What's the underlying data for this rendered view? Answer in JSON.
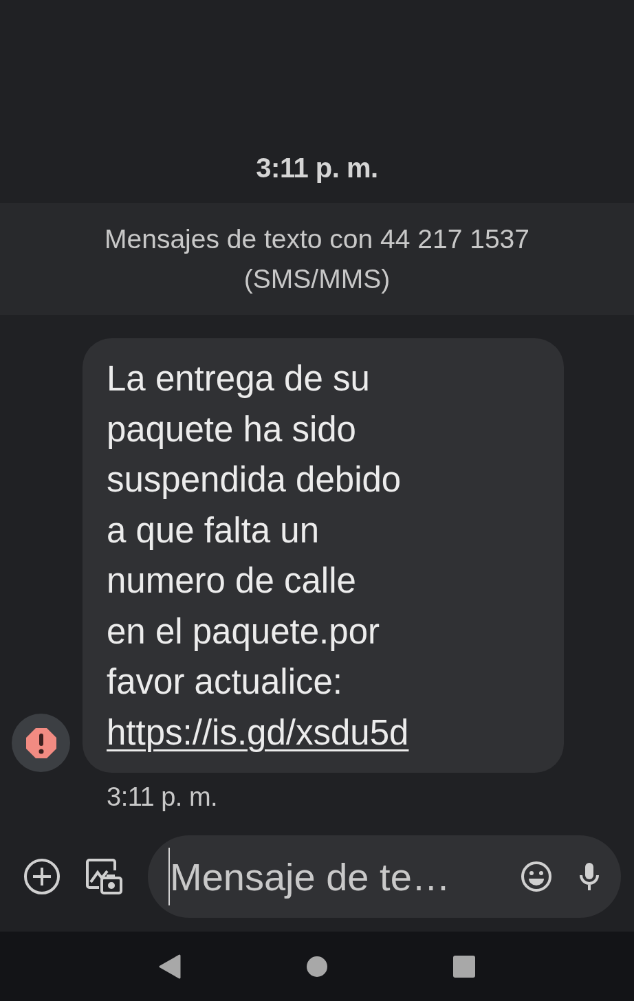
{
  "conversation": {
    "time_header": "3:11 p. m.",
    "banner": {
      "line_1": "Mensajes de texto con 44 217 1537",
      "line_2": "(SMS/MMS)"
    },
    "messages": [
      {
        "lines": [
          "La entrega de su",
          "paquete ha sido",
          "suspendida debido",
          "a que falta un",
          "numero de calle",
          "en el paquete.por",
          "favor actualice:"
        ],
        "link": "https://is.gd/xsdu5d",
        "time": "3:11 p. m.",
        "failed": true
      }
    ]
  },
  "composer": {
    "placeholder": "Mensaje de te…"
  }
}
